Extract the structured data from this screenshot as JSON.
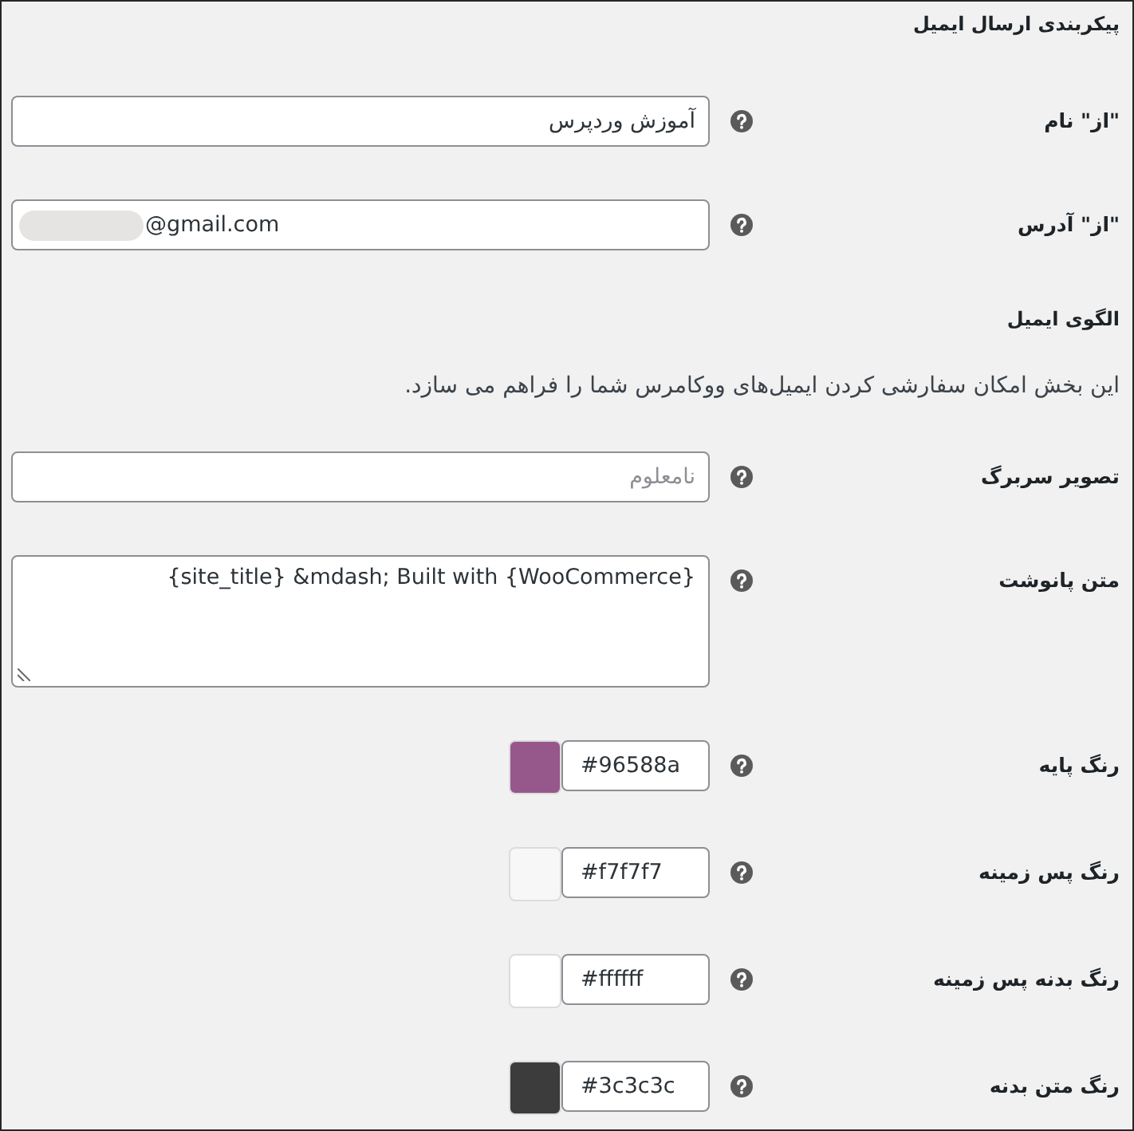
{
  "sections": [
    {
      "title": "پیکربندی ارسال ایمیل",
      "fields": [
        {
          "kind": "text",
          "label": "\"از\" نام",
          "value": "آموزش وردپرس"
        },
        {
          "kind": "email",
          "label": "\"از\" آدرس",
          "value": "@gmail.com",
          "redacted": true
        }
      ]
    },
    {
      "title": "الگوی ایمیل",
      "description": "این بخش امکان سفارشی کردن ایمیل‌های ووکامرس شما را فراهم می سازد.",
      "fields": [
        {
          "kind": "text",
          "label": "تصویر سربرگ",
          "placeholder": "نامعلوم"
        },
        {
          "kind": "textarea",
          "label": "متن پانوشت",
          "value": "{site_title} &mdash; Built with {WooCommerce}"
        },
        {
          "kind": "color",
          "label": "رنگ پایه",
          "value": "#96588a",
          "color": "#96588a"
        },
        {
          "kind": "color",
          "label": "رنگ پس زمینه",
          "value": "#f7f7f7",
          "color": "#f7f7f7"
        },
        {
          "kind": "color",
          "label": "رنگ بدنه پس زمینه",
          "value": "#ffffff",
          "color": "#ffffff"
        },
        {
          "kind": "color",
          "label": "رنگ متن بدنه",
          "value": "#3c3c3c",
          "color": "#3c3c3c"
        }
      ]
    }
  ]
}
